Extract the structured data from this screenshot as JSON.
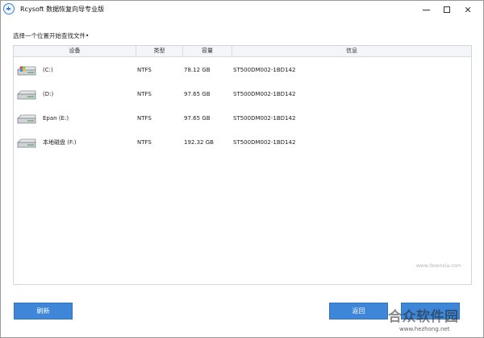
{
  "window": {
    "title": "Rcysoft 数据恢复向导专业版",
    "icon": "app-logo-icon",
    "controls": [
      "minimize-icon",
      "maximize-icon",
      "close-icon"
    ]
  },
  "instruction": "选择一个位置开始查找文件•",
  "table": {
    "headers": {
      "device": "设备",
      "type": "类型",
      "capacity": "容量",
      "info": "信息"
    },
    "rows": [
      {
        "name": "(C:)",
        "type": "NTFS",
        "capacity": "78.12 GB",
        "info": "ST500DM002-1BD142",
        "icon": "windows-system-drive-icon"
      },
      {
        "name": "(D:)",
        "type": "NTFS",
        "capacity": "97.65 GB",
        "info": "ST500DM002-1BD142",
        "icon": "hard-drive-icon"
      },
      {
        "name": "Epan (E:)",
        "type": "NTFS",
        "capacity": "97.65 GB",
        "info": "ST500DM002-1BD142",
        "icon": "hard-drive-icon"
      },
      {
        "name": "本地磁盘 (F:)",
        "type": "NTFS",
        "capacity": "192.32 GB",
        "info": "ST500DM002-1BD142",
        "icon": "hard-drive-icon"
      }
    ]
  },
  "buttons": {
    "refresh": "刷新",
    "back": "返回",
    "scan": ""
  },
  "watermark": {
    "main": "合众软件园",
    "url": "www.hezhong.net",
    "faint": "www.downxia.com"
  },
  "colors": {
    "accent": "#3d86d8",
    "header_bg": "#f3f5f8",
    "border": "#cfd6df"
  }
}
